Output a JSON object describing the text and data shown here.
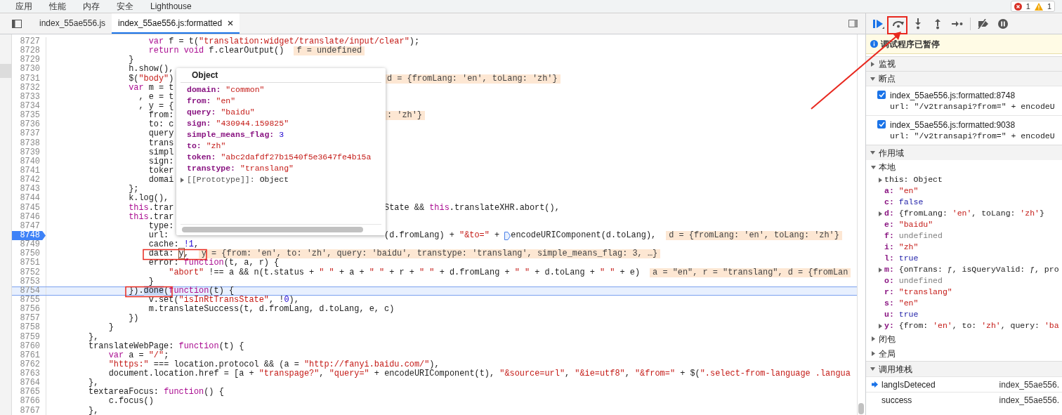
{
  "top_tabs": [
    {
      "label": "应用"
    },
    {
      "label": "性能"
    },
    {
      "label": "内存"
    },
    {
      "label": "安全"
    },
    {
      "label": "Lighthouse"
    }
  ],
  "issues": {
    "errors": "1",
    "warnings": "1"
  },
  "editor": {
    "tabs": [
      {
        "label": "index_55ae556.js",
        "selected": false,
        "closable": false
      },
      {
        "label": "index_55ae556.js:formatted",
        "selected": true,
        "closable": true
      }
    ],
    "lines": [
      {
        "n": "8727",
        "code": [
          {
            "text": "                    var",
            "kind": "kw"
          },
          {
            "text": " f = t(",
            "kind": "plain"
          },
          {
            "text": "\"translation:widget/translate/input/clear\"",
            "kind": "str"
          },
          {
            "text": ");",
            "kind": "plain"
          }
        ]
      },
      {
        "n": "8728",
        "code": [
          {
            "text": "                    return",
            "kind": "kw"
          },
          {
            "text": " void",
            "kind": "kw"
          },
          {
            "text": " f.clearOutput()",
            "kind": "plain"
          }
        ],
        "hint": "f = undefined"
      },
      {
        "n": "8729",
        "code": [
          {
            "text": "                }",
            "kind": "plain"
          }
        ]
      },
      {
        "n": "8730",
        "code": [
          {
            "text": "                h.show(),",
            "kind": "plain"
          }
        ]
      },
      {
        "n": "8731",
        "code": [
          {
            "text": "                $(",
            "kind": "plain"
          },
          {
            "text": "\"body\"",
            "kind": "str"
          },
          {
            "text": ")",
            "kind": "plain"
          }
        ],
        "tail_hint": "d = {fromLang: 'en', toLang: 'zh'}"
      },
      {
        "n": "8732",
        "code": [
          {
            "text": "                var",
            "kind": "kw"
          },
          {
            "text": " m = t",
            "kind": "plain"
          }
        ]
      },
      {
        "n": "8733",
        "code": [
          {
            "text": "                  , e = t",
            "kind": "plain"
          }
        ]
      },
      {
        "n": "8734",
        "code": [
          {
            "text": "                  , y = {",
            "kind": "plain"
          }
        ]
      },
      {
        "n": "8735",
        "code": [
          {
            "text": "                    from:",
            "kind": "plain"
          }
        ],
        "tail_hint": ": 'zh'}"
      },
      {
        "n": "8736",
        "code": [
          {
            "text": "                    to: c",
            "kind": "plain"
          }
        ]
      },
      {
        "n": "8737",
        "code": [
          {
            "text": "                    query",
            "kind": "plain"
          }
        ]
      },
      {
        "n": "8738",
        "code": [
          {
            "text": "                    trans",
            "kind": "plain"
          }
        ]
      },
      {
        "n": "8739",
        "code": [
          {
            "text": "                    simpl",
            "kind": "plain"
          }
        ]
      },
      {
        "n": "8740",
        "code": [
          {
            "text": "                    sign:",
            "kind": "plain"
          }
        ]
      },
      {
        "n": "8741",
        "code": [
          {
            "text": "                    toker",
            "kind": "plain"
          }
        ]
      },
      {
        "n": "8742",
        "code": [
          {
            "text": "                    domai",
            "kind": "plain"
          }
        ]
      },
      {
        "n": "8743",
        "code": [
          {
            "text": "                };",
            "kind": "plain"
          }
        ]
      },
      {
        "n": "8744",
        "code": [
          {
            "text": "                k.log(),",
            "kind": "plain"
          }
        ]
      },
      {
        "n": "8745",
        "code": [
          {
            "text": "                this",
            "kind": "kw"
          },
          {
            "text": ".trar",
            "kind": "plain"
          }
        ],
        "tail": [
          {
            "text": "State && ",
            "kind": "plain"
          },
          {
            "text": "this",
            "kind": "kw"
          },
          {
            "text": ".translateXHR.abort(),",
            "kind": "plain"
          }
        ]
      },
      {
        "n": "8746",
        "code": [
          {
            "text": "                this",
            "kind": "kw"
          },
          {
            "text": ".trar",
            "kind": "plain"
          }
        ]
      },
      {
        "n": "8747",
        "code": [
          {
            "text": "                    type:",
            "kind": "plain"
          }
        ]
      },
      {
        "n": "8748",
        "breakpoint": true,
        "code": [
          {
            "text": "                    url:",
            "kind": "plain"
          }
        ],
        "tail": [
          {
            "text": "(d.fromLang) + ",
            "kind": "plain"
          },
          {
            "text": "\"&to=\"",
            "kind": "str"
          },
          {
            "text": " + ",
            "kind": "plain"
          },
          {
            "text": "encodeURIComponent(d.toLang),",
            "kind": "bpm"
          }
        ],
        "tail_hint": "d = {fromLang: 'en', toLang: 'zh'}"
      },
      {
        "n": "8749",
        "code": [
          {
            "text": "                    cache: ",
            "kind": "plain"
          },
          {
            "text": "!1",
            "kind": "num"
          },
          {
            "text": ",",
            "kind": "plain"
          }
        ]
      },
      {
        "n": "8750",
        "code": [
          {
            "text": "                    data: ",
            "kind": "plain"
          },
          {
            "text": "y",
            "kind": "hover"
          },
          {
            "text": ",",
            "kind": "plain"
          }
        ],
        "hint": "y = {from: 'en', to: 'zh', query: 'baidu', transtype: 'translang', simple_means_flag: 3, …}"
      },
      {
        "n": "8751",
        "code": [
          {
            "text": "                    error: ",
            "kind": "plain"
          },
          {
            "text": "function",
            "kind": "kw"
          },
          {
            "text": "(t, a, r) {",
            "kind": "plain"
          }
        ]
      },
      {
        "n": "8752",
        "code": [
          {
            "text": "                        \"abort\"",
            "kind": "str"
          },
          {
            "text": " !== a && n(t.status + ",
            "kind": "plain"
          },
          {
            "text": "\" \"",
            "kind": "str"
          },
          {
            "text": " + a + ",
            "kind": "plain"
          },
          {
            "text": "\" \"",
            "kind": "str"
          },
          {
            "text": " + r + ",
            "kind": "plain"
          },
          {
            "text": "\" \"",
            "kind": "str"
          },
          {
            "text": " + d.fromLang + ",
            "kind": "plain"
          },
          {
            "text": "\" \"",
            "kind": "str"
          },
          {
            "text": " + d.toLang + ",
            "kind": "plain"
          },
          {
            "text": "\" \"",
            "kind": "str"
          },
          {
            "text": " + e)",
            "kind": "plain"
          }
        ],
        "hint": "a = \"en\", r = \"translang\", d = {fromLan"
      },
      {
        "n": "8753",
        "code": [
          {
            "text": "                    }",
            "kind": "plain"
          }
        ]
      },
      {
        "n": "8754",
        "current": true,
        "code": [
          {
            "text": "                }).",
            "kind": "plain"
          },
          {
            "text": "done",
            "kind": "sel"
          },
          {
            "text": "(",
            "kind": "plain"
          },
          {
            "text": "function",
            "kind": "kw"
          },
          {
            "text": "(t) {",
            "kind": "plain"
          }
        ]
      },
      {
        "n": "8755",
        "code": [
          {
            "text": "                    v.set(",
            "kind": "plain"
          },
          {
            "text": "\"isInRtTransState\"",
            "kind": "str"
          },
          {
            "text": ", !",
            "kind": "plain"
          },
          {
            "text": "0",
            "kind": "num"
          },
          {
            "text": "),",
            "kind": "plain"
          }
        ]
      },
      {
        "n": "8756",
        "code": [
          {
            "text": "                    m.translateSuccess(t, d.fromLang, d.toLang, e, c)",
            "kind": "plain"
          }
        ]
      },
      {
        "n": "8757",
        "code": [
          {
            "text": "                })",
            "kind": "plain"
          }
        ]
      },
      {
        "n": "8758",
        "code": [
          {
            "text": "            }",
            "kind": "plain"
          }
        ]
      },
      {
        "n": "8759",
        "code": [
          {
            "text": "        },",
            "kind": "plain"
          }
        ]
      },
      {
        "n": "8760",
        "code": [
          {
            "text": "        translateWebPage: ",
            "kind": "plain"
          },
          {
            "text": "function",
            "kind": "kw"
          },
          {
            "text": "(t) {",
            "kind": "plain"
          }
        ]
      },
      {
        "n": "8761",
        "code": [
          {
            "text": "            var",
            "kind": "kw"
          },
          {
            "text": " a = ",
            "kind": "plain"
          },
          {
            "text": "\"/\"",
            "kind": "str"
          },
          {
            "text": ";",
            "kind": "plain"
          }
        ]
      },
      {
        "n": "8762",
        "code": [
          {
            "text": "            \"https:\"",
            "kind": "str"
          },
          {
            "text": " === location.protocol && (a = ",
            "kind": "plain"
          },
          {
            "text": "\"http://fanyi.baidu.com/\"",
            "kind": "str"
          },
          {
            "text": "),",
            "kind": "plain"
          }
        ]
      },
      {
        "n": "8763",
        "code": [
          {
            "text": "            document.location.href = [a + ",
            "kind": "plain"
          },
          {
            "text": "\"transpage?\"",
            "kind": "str"
          },
          {
            "text": ", ",
            "kind": "plain"
          },
          {
            "text": "\"query=\"",
            "kind": "str"
          },
          {
            "text": " + encodeURIComponent(t), ",
            "kind": "plain"
          },
          {
            "text": "\"&source=url\"",
            "kind": "str"
          },
          {
            "text": ", ",
            "kind": "plain"
          },
          {
            "text": "\"&ie=utf8\"",
            "kind": "str"
          },
          {
            "text": ", ",
            "kind": "plain"
          },
          {
            "text": "\"&from=\"",
            "kind": "str"
          },
          {
            "text": " + $(",
            "kind": "plain"
          },
          {
            "text": "\".select-from-language .langua",
            "kind": "str"
          }
        ]
      },
      {
        "n": "8764",
        "code": [
          {
            "text": "        },",
            "kind": "plain"
          }
        ]
      },
      {
        "n": "8765",
        "code": [
          {
            "text": "        textareaFocus: ",
            "kind": "plain"
          },
          {
            "text": "function",
            "kind": "kw"
          },
          {
            "text": "() {",
            "kind": "plain"
          }
        ]
      },
      {
        "n": "8766",
        "code": [
          {
            "text": "            c.focus()",
            "kind": "plain"
          }
        ]
      },
      {
        "n": "8767",
        "code": [
          {
            "text": "        },",
            "kind": "plain"
          }
        ]
      }
    ],
    "popover": {
      "title": "Object",
      "properties": [
        {
          "key": "domain:",
          "value": [
            {
              "text": "\"common\"",
              "kind": "str"
            }
          ]
        },
        {
          "key": "from:",
          "value": [
            {
              "text": "\"en\"",
              "kind": "str"
            }
          ]
        },
        {
          "key": "query:",
          "value": [
            {
              "text": "\"baidu\"",
              "kind": "str"
            }
          ]
        },
        {
          "key": "sign:",
          "value": [
            {
              "text": "\"430944.159825\"",
              "kind": "str"
            }
          ]
        },
        {
          "key": "simple_means_flag:",
          "value": [
            {
              "text": "3",
              "kind": "num"
            }
          ]
        },
        {
          "key": "to:",
          "value": [
            {
              "text": "\"zh\"",
              "kind": "str"
            }
          ]
        },
        {
          "key": "token:",
          "value": [
            {
              "text": "\"abc2dafdf27b1540f5e3647fe4b15a",
              "kind": "str"
            }
          ]
        },
        {
          "key": "transtype:",
          "value": [
            {
              "text": "\"translang\"",
              "kind": "str"
            }
          ]
        }
      ],
      "prototype": {
        "key": "[[Prototype]]:",
        "value": "Object"
      }
    }
  },
  "debugger": {
    "paused_message": "调试程序已暂停",
    "watch": {
      "title": "监视",
      "expanded": false
    },
    "breakpoints": {
      "title": "断点",
      "expanded": true,
      "items": [
        {
          "location": "index_55ae556.js:formatted:8748",
          "code": "url: \"/v2transapi?from=\" + encodeU",
          "checked": true
        },
        {
          "location": "index_55ae556.js:formatted:9038",
          "code": "url: \"/v2transapi?from=\" + encodeU",
          "checked": true
        }
      ]
    },
    "scope": {
      "title": "作用域",
      "expanded": true,
      "groups": [
        {
          "title": "本地",
          "expanded": true,
          "vars": [
            {
              "name": "this:",
              "kind": "receiver",
              "expandable": true,
              "value": [
                {
                  "text": "Object",
                  "kind": "plain"
                }
              ]
            },
            {
              "name": "a:",
              "kind": "local",
              "expandable": false,
              "value": [
                {
                  "text": "\"en\"",
                  "kind": "str"
                }
              ]
            },
            {
              "name": "c:",
              "kind": "local",
              "expandable": false,
              "value": [
                {
                  "text": "false",
                  "kind": "lit"
                }
              ]
            },
            {
              "name": "d:",
              "kind": "local",
              "expandable": true,
              "value": [
                {
                  "text": "{fromLang: ",
                  "kind": "plain"
                },
                {
                  "text": "'en'",
                  "kind": "str"
                },
                {
                  "text": ", toLang: ",
                  "kind": "plain"
                },
                {
                  "text": "'zh'",
                  "kind": "str"
                },
                {
                  "text": "}",
                  "kind": "plain"
                }
              ]
            },
            {
              "name": "e:",
              "kind": "local",
              "expandable": false,
              "value": [
                {
                  "text": "\"baidu\"",
                  "kind": "str"
                }
              ]
            },
            {
              "name": "f:",
              "kind": "local",
              "expandable": false,
              "value": [
                {
                  "text": "undefined",
                  "kind": "undef"
                }
              ]
            },
            {
              "name": "i:",
              "kind": "local",
              "expandable": false,
              "value": [
                {
                  "text": "\"zh\"",
                  "kind": "str"
                }
              ]
            },
            {
              "name": "l:",
              "kind": "local",
              "expandable": false,
              "value": [
                {
                  "text": "true",
                  "kind": "lit"
                }
              ]
            },
            {
              "name": "m:",
              "kind": "local",
              "expandable": true,
              "value": [
                {
                  "text": "{onTrans: ƒ, isQueryValid: ƒ, pro",
                  "kind": "plain"
                }
              ]
            },
            {
              "name": "o:",
              "kind": "local",
              "expandable": false,
              "value": [
                {
                  "text": "undefined",
                  "kind": "undef"
                }
              ]
            },
            {
              "name": "r:",
              "kind": "local",
              "expandable": false,
              "value": [
                {
                  "text": "\"translang\"",
                  "kind": "str"
                }
              ]
            },
            {
              "name": "s:",
              "kind": "local",
              "expandable": false,
              "value": [
                {
                  "text": "\"en\"",
                  "kind": "str"
                }
              ]
            },
            {
              "name": "u:",
              "kind": "local",
              "expandable": false,
              "value": [
                {
                  "text": "true",
                  "kind": "lit"
                }
              ]
            },
            {
              "name": "y:",
              "kind": "local",
              "expandable": true,
              "value": [
                {
                  "text": "{from: ",
                  "kind": "plain"
                },
                {
                  "text": "'en'",
                  "kind": "str"
                },
                {
                  "text": ", to: ",
                  "kind": "plain"
                },
                {
                  "text": "'zh'",
                  "kind": "str"
                },
                {
                  "text": ", query: ",
                  "kind": "plain"
                },
                {
                  "text": "'ba",
                  "kind": "str"
                }
              ]
            }
          ]
        },
        {
          "title": "闭包",
          "expanded": false
        },
        {
          "title": "全局",
          "expanded": false
        }
      ]
    },
    "call_stack": {
      "title": "调用堆栈",
      "expanded": true,
      "frames": [
        {
          "name": "langIsDeteced",
          "location": "index_55ae556.",
          "selected": true
        },
        {
          "name": "success",
          "location": "index_55ae556.",
          "selected": false
        }
      ]
    }
  }
}
